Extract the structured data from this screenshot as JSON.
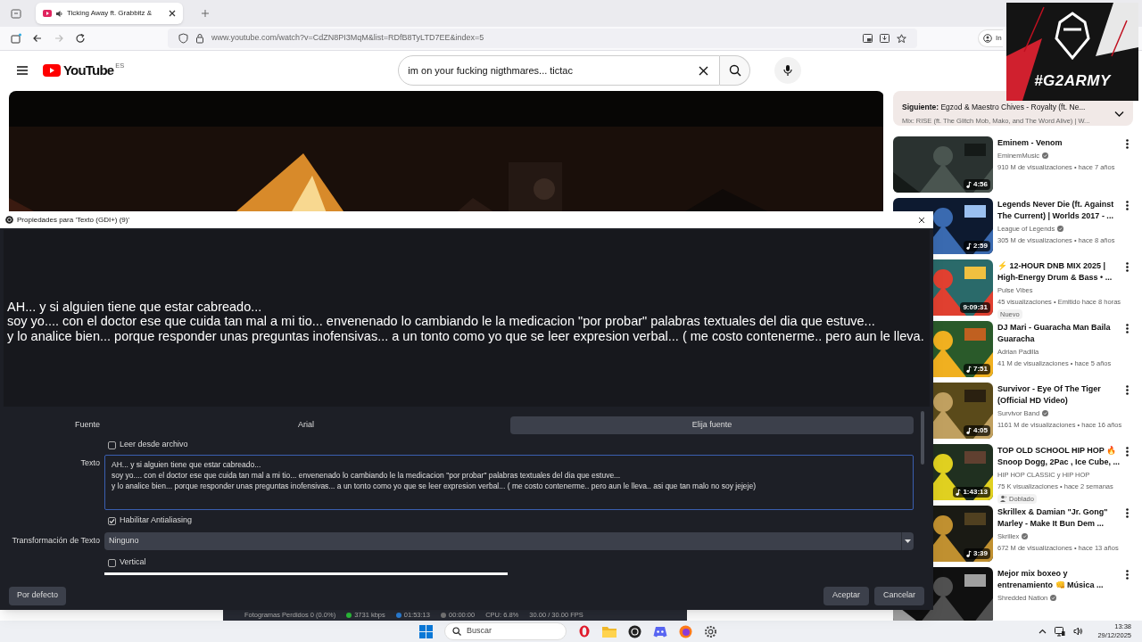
{
  "browser": {
    "tab": {
      "title": "Ticking Away ft. Grabbitz &",
      "audio_playing": true
    },
    "url": "www.youtube.com/watch?v=CdZN8PI3MqM&list=RDfB8TyLTD7EE&index=5",
    "forward_disabled": true,
    "profile_label": "In"
  },
  "youtube": {
    "logo": "YouTube",
    "region": "ES",
    "search": {
      "value": "im on your fucking nigthmares... tictac"
    },
    "up_next": {
      "label": "Siguiente:",
      "title": "Egzod & Maestro Chives - Royalty (ft. Ne...",
      "mix": "Mix: RISE (ft. The Glitch Mob, Mako, and The Word Alive) | W..."
    },
    "playlist": [
      {
        "title_lines": [
          "Eminem - Venom"
        ],
        "channel": "EminemMusic",
        "verified": true,
        "views": "910 M de visualizaciones • hace 7 años",
        "duration": "4:56",
        "music_note": true
      },
      {
        "title_lines": [
          "Legends Never Die (ft. Against",
          "The Current) | Worlds 2017 - ..."
        ],
        "channel": "League of Legends",
        "verified": true,
        "views": "305 M de visualizaciones • hace 8 años",
        "duration": "2:59",
        "music_note": true
      },
      {
        "title_lines": [
          "⚡ 12-HOUR DNB MIX 2025 |",
          "High-Energy Drum & Bass • ..."
        ],
        "channel": "Pulse Vibes",
        "verified": false,
        "views": "45 visualizaciones • Emitido hace 8 horas",
        "duration": "9:09:31",
        "music_note": false,
        "badge": {
          "kind": "plain",
          "text": "Nuevo"
        }
      },
      {
        "title_lines": [
          "DJ Mari - Guaracha Man   Baila",
          "Guaracha"
        ],
        "channel": "Adrian Padilla",
        "verified": false,
        "views": "41 M de visualizaciones • hace 5 años",
        "duration": "7:51",
        "music_note": true
      },
      {
        "title_lines": [
          "Survivor - Eye Of The Tiger",
          "(Official HD Video)"
        ],
        "channel": "Survivor Band",
        "verified": true,
        "views": "1161 M de visualizaciones • hace 16 años",
        "duration": "4:05",
        "music_note": true
      },
      {
        "title_lines": [
          "TOP OLD SCHOOL HIP HOP 🔥",
          "Snoop Dogg, 2Pac , Ice Cube, ..."
        ],
        "channel": "HIP HOP CLASSIC y HIP HOP",
        "verified": false,
        "views": "75 K visualizaciones • hace 2 semanas",
        "duration": "1:43:13",
        "music_note": true,
        "badge": {
          "kind": "dubbed",
          "text": "Doblado"
        }
      },
      {
        "title_lines": [
          "Skrillex & Damian \"Jr. Gong\"",
          "Marley - Make It Bun Dem ..."
        ],
        "channel": "Skrillex",
        "verified": true,
        "views": "672 M de visualizaciones • hace 13 años",
        "duration": "3:39",
        "music_note": true
      },
      {
        "title_lines": [
          "Mejor mix boxeo y",
          "entrenamiento 👊 Música ..."
        ],
        "channel": "Shredded Nation",
        "verified": true
      }
    ]
  },
  "overlay": {
    "text": "#G2ARMY"
  },
  "dialog": {
    "title": "Propiedades para 'Texto (GDI+) (9)'",
    "preview_lines": [
      "AH... y si alguien tiene que estar cabreado...",
      "soy yo.... con el doctor ese que cuida tan mal a mi tio... envenenado lo cambiando le la medicacion \"por probar\" palabras textuales del dia que estuve...",
      "y lo analice bien... porque responder unas preguntas inofensivas... a un tonto como yo que se leer expresion verbal...  ( me costo contenerme.. pero aun le lleva."
    ],
    "font_label": "Fuente",
    "font_name": "Arial",
    "choose_font": "Elija fuente",
    "read_file": {
      "label": "Leer desde archivo",
      "checked": false
    },
    "text_label": "Texto",
    "text_lines": [
      "AH... y si alguien tiene que estar cabreado...",
      "soy yo.... con el doctor ese que cuida tan mal a mi tio... envenenado lo cambiando le la medicacion \"por probar\" palabras textuales del dia que estuve...",
      "y lo analice bien... porque responder unas preguntas inofensivas... a un tonto como yo que se leer expresion verbal...  ( me costo contenerme.. pero aun le lleva.. asi que tan malo no soy jejeje)"
    ],
    "antialias": {
      "label": "Habilitar Antialiasing",
      "checked": true
    },
    "transform": {
      "label": "Transformación de Texto",
      "value": "Ninguno"
    },
    "vertical": {
      "label": "Vertical",
      "checked": false
    },
    "buttons": {
      "defaults": "Por defecto",
      "ok": "Aceptar",
      "cancel": "Cancelar"
    }
  },
  "obs_status": [
    "Fotogramas Perdidos 0 (0.0%)",
    "3731 kbps",
    "01:53:13",
    "00:00:00",
    "CPU: 6.8%",
    "30.00 / 30.00 FPS"
  ],
  "taskbar": {
    "search_placeholder": "Buscar",
    "time": "13:38",
    "date": "29/12/2025"
  }
}
